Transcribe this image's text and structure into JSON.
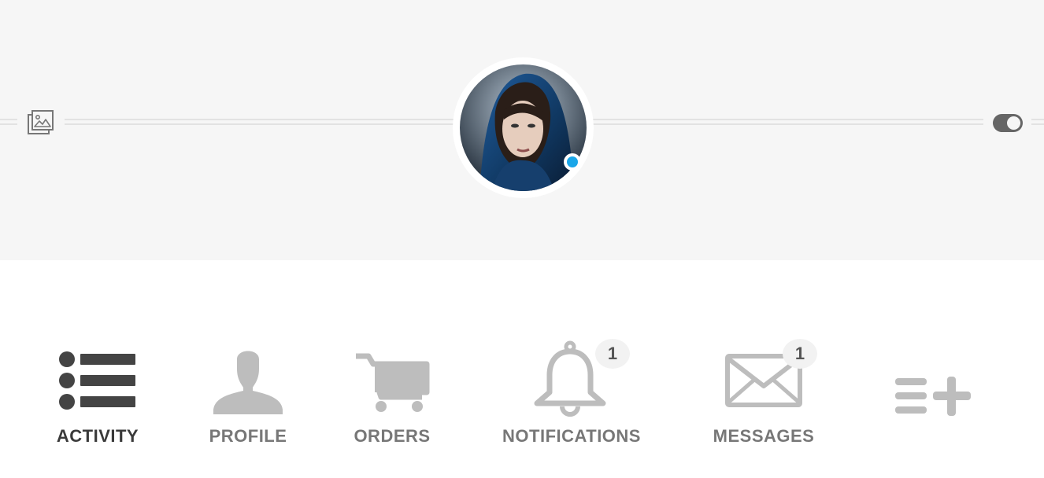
{
  "cover": {
    "background_color": "#f6f6f6",
    "change_cover_icon": "image-stack-icon",
    "toggle_icon": "toggle-icon"
  },
  "profile": {
    "avatar_icon": "profile-photo",
    "status_color": "#1aa6e8"
  },
  "tabs": [
    {
      "label": "ACTIVITY",
      "icon": "list-icon",
      "active": true
    },
    {
      "label": "PROFILE",
      "icon": "person-icon",
      "active": false
    },
    {
      "label": "ORDERS",
      "icon": "cart-icon",
      "active": false
    },
    {
      "label": "NOTIFICATIONS",
      "icon": "bell-icon",
      "active": false,
      "badge": "1"
    },
    {
      "label": "MESSAGES",
      "icon": "envelope-icon",
      "active": false,
      "badge": "1"
    },
    {
      "label": "",
      "icon": "add-menu-icon",
      "active": false
    }
  ],
  "colors": {
    "active_tab": "#3a3a3a",
    "inactive_tab": "#777777",
    "icon_inactive": "#bdbdbd"
  }
}
